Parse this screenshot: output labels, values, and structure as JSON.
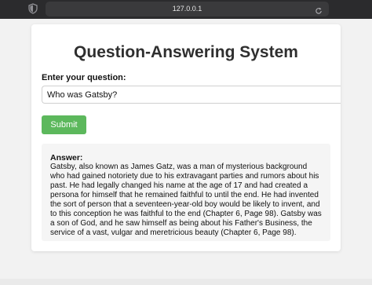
{
  "browser": {
    "url": "127.0.0.1"
  },
  "page": {
    "title": "Question-Answering System",
    "question_label": "Enter your question:",
    "question_value": "Who was Gatsby?",
    "submit_label": "Submit",
    "answer_label": "Answer:",
    "answer_text": "Gatsby, also known as James Gatz, was a man of mysterious background who had gained notoriety due to his extravagant parties and rumors about his past. He had legally changed his name at the age of 17 and had created a persona for himself that he remained faithful to until the end. He had invented the sort of person that a seventeen-year-old boy would be likely to invent, and to this conception he was faithful to the end (Chapter 6, Page 98). Gatsby was a son of God, and he saw himself as being about his Father's Business, the service of a vast, vulgar and meretricious beauty (Chapter 6, Page 98)."
  },
  "colors": {
    "submit_bg": "#5cb85c",
    "page_bg": "#f2f2f2",
    "answer_bg": "#f5f5f5"
  },
  "icons": [
    "shield-icon",
    "reload-icon"
  ]
}
